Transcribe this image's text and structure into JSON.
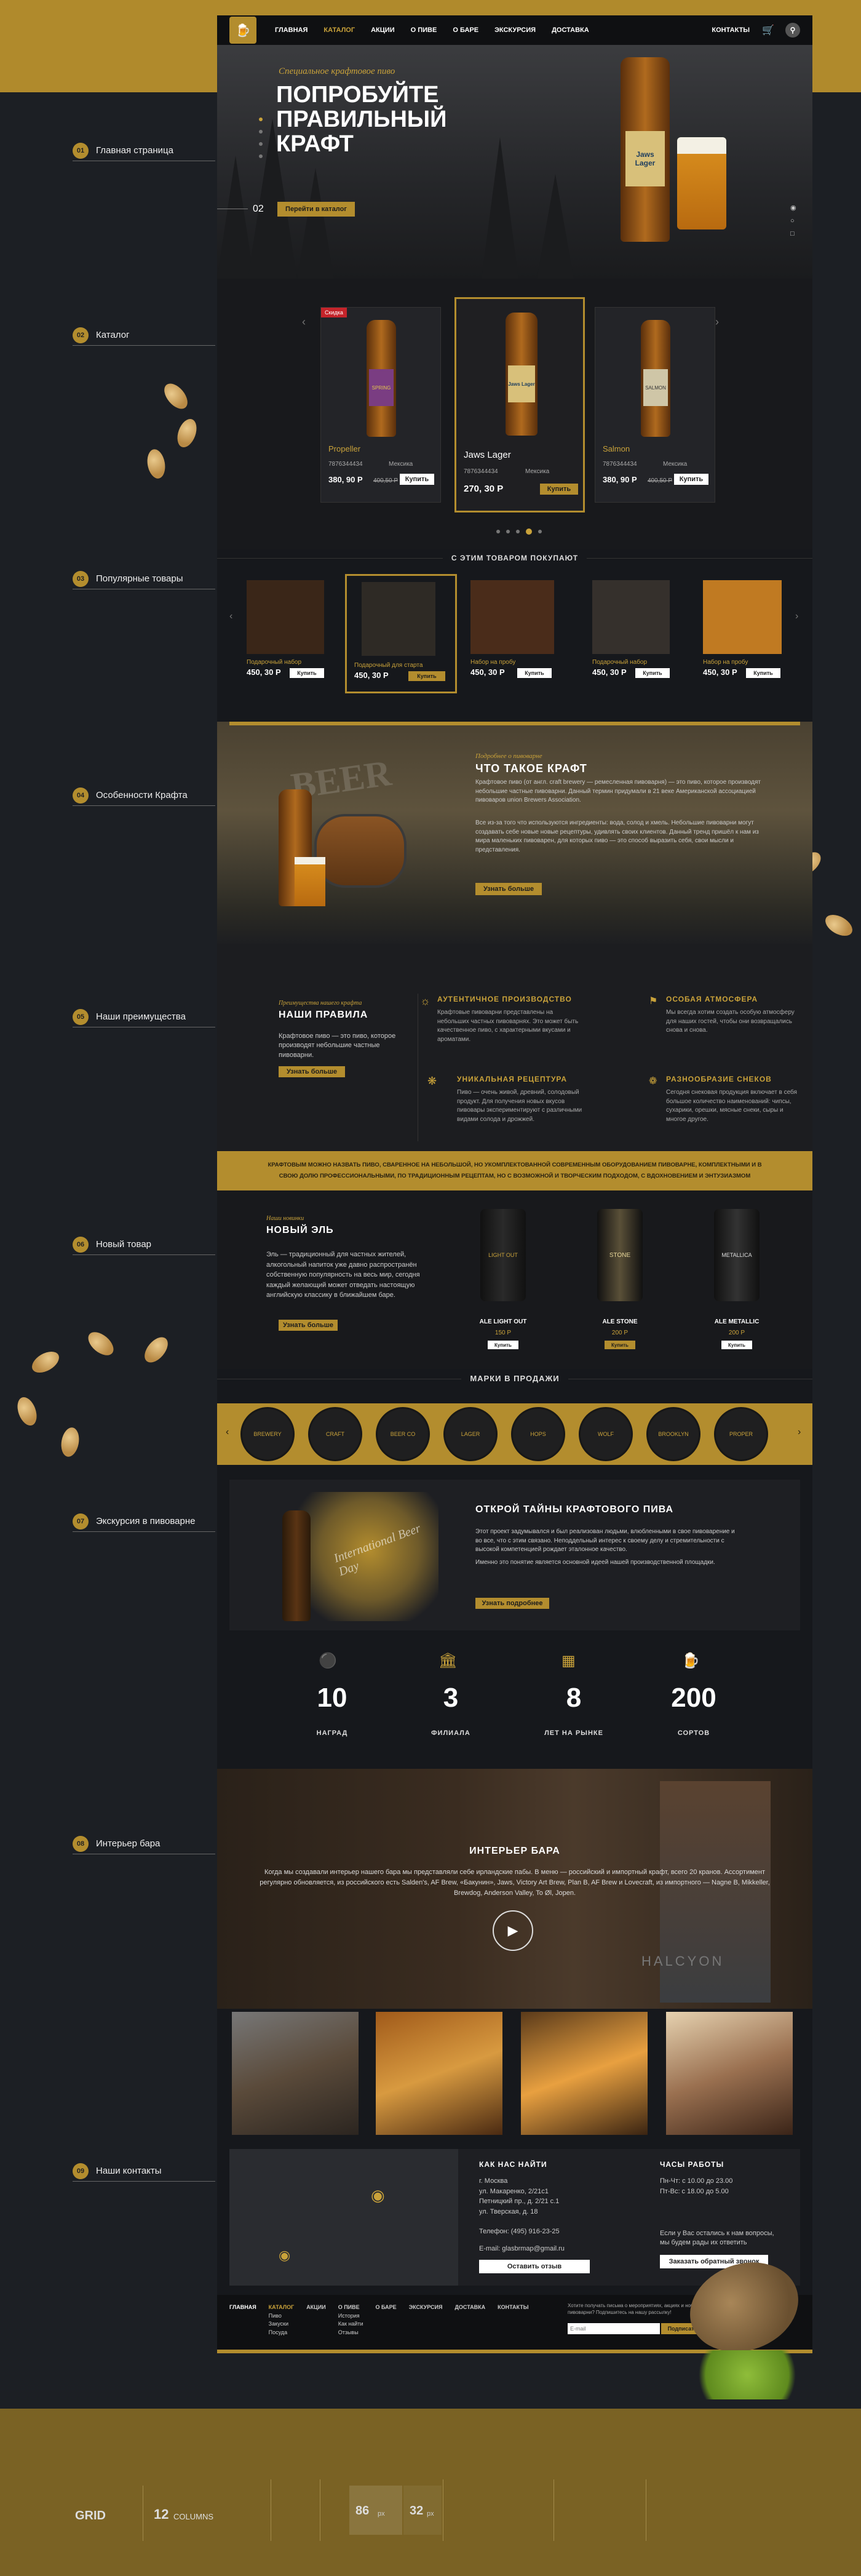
{
  "nav": {
    "items": [
      "ГЛАВНАЯ",
      "КАТАЛОГ",
      "АКЦИИ",
      "О ПИВЕ",
      "О БАРЕ",
      "ЭКСКУРСИЯ",
      "ДОСТАВКА"
    ],
    "contacts": "КОНТАКТЫ"
  },
  "left_index": [
    {
      "num": "01",
      "label": "Главная страница"
    },
    {
      "num": "02",
      "label": "Каталог"
    },
    {
      "num": "03",
      "label": "Популярные товары"
    },
    {
      "num": "04",
      "label": "Особенности Крафта"
    },
    {
      "num": "05",
      "label": "Наши преимущества"
    },
    {
      "num": "06",
      "label": "Новый товар"
    },
    {
      "num": "07",
      "label": "Экскурсия в пивоварне"
    },
    {
      "num": "08",
      "label": "Интерьер бара"
    },
    {
      "num": "09",
      "label": "Наши контакты"
    }
  ],
  "hero": {
    "script": "Специальное крафтовое пиво",
    "title1": "ПОПРОБУЙТЕ",
    "title2": "ПРАВИЛЬНЫЙ",
    "title3": "КРАФТ",
    "slide": "02",
    "button": "Перейти в каталог",
    "bottle_label": "Jaws Lager"
  },
  "catalog": {
    "products": [
      {
        "name": "Propeller",
        "code": "7876344434",
        "tag": "Мексика",
        "price": "380, 90 Р",
        "old": "400,50 Р",
        "btn": "Купить",
        "badge": "Скидка",
        "label": "SPRING"
      },
      {
        "name": "Jaws Lager",
        "code": "7876344434",
        "tag": "Мексика",
        "price": "270, 30 Р",
        "old": "",
        "btn": "Купить",
        "badge": "",
        "label": "Jaws Lager"
      },
      {
        "name": "Salmon",
        "code": "7876344434",
        "tag": "Мексика",
        "price": "380, 90 Р",
        "old": "400,50 Р",
        "btn": "Купить",
        "badge": "",
        "label": "SALMON"
      }
    ]
  },
  "popular": {
    "title": "С ЭТИМ ТОВАРОМ ПОКУПАЮТ",
    "items": [
      {
        "name": "Подарочный набор",
        "price": "450, 30 Р",
        "btn": "Купить"
      },
      {
        "name": "Подарочный для старта",
        "price": "450, 30 Р",
        "btn": "Купить"
      },
      {
        "name": "Набор на пробу",
        "price": "450, 30 Р",
        "btn": "Купить"
      },
      {
        "name": "Подарочный набор",
        "price": "450, 30 Р",
        "btn": "Купить"
      },
      {
        "name": "Набор на пробу",
        "price": "450, 30 Р",
        "btn": "Купить"
      }
    ]
  },
  "craft": {
    "script": "Подробнее о пивоварне",
    "title": "ЧТО ТАКОЕ КРАФТ",
    "text1": "Крафтовое пиво (от англ. craft brewery — ремесленная пивоварня) — это пиво, которое производят небольшие частные пивоварни. Данный термин придумали в 21 веке Американской ассоциацией пивоваров union Brewers Association.",
    "text2": "Все из-за того что используются ингредиенты: вода, солод и хмель. Небольшие пивоварни могут создавать себе новые новые рецептуры, удивлять своих клиентов. Данный тренд пришёл к нам из мира маленьких пивоварен, для которых пиво — это способ выразить себя, свои мысли и представления.",
    "button": "Узнать больше",
    "barrel_text": "BEER"
  },
  "advantages": {
    "script": "Преимущества нашего крафта",
    "title": "НАШИ ПРАВИЛА",
    "text": "Крафтовое пиво — это пиво, которое производят небольшие частные пивоварни.",
    "button": "Узнать больше",
    "features": [
      {
        "title": "АУТЕНТИЧНОЕ ПРОИЗВОДСТВО",
        "text": "Крафтовые пивоварни представлены на небольших частных пивоварнях. Это может быть качественное пиво, с характерными вкусами и ароматами."
      },
      {
        "title": "ОСОБАЯ АТМОСФЕРА",
        "text": "Мы всегда хотим создать особую атмосферу для наших гостей, чтобы они возвращались снова и снова."
      },
      {
        "title": "УНИКАЛЬНАЯ РЕЦЕПТУРА",
        "text": "Пиво — очень живой, древний, солодовый продукт. Для получения новых вкусов пивовары экспериментируют с различными видами солода и дрожжей."
      },
      {
        "title": "РАЗНООБРАЗИЕ СНЕКОВ",
        "text": "Сегодня снековая продукция включает в себя большое количество наименований: чипсы, сухарики, орешки, мясные снеки, сыры и многое другое."
      }
    ]
  },
  "banner": {
    "text": "КРАФТОВЫМ МОЖНО НАЗВАТЬ ПИВО, СВАРЕННОЕ НА НЕБОЛЬШОЙ, НО УКОМПЛЕКТОВАННОЙ СОВРЕМЕННЫМ ОБОРУДОВАНИЕМ ПИВОВАРНЕ, КОМПЛЕКТНЫМИ И В СВОЮ ДОЛЮ ПРОФЕССИОНАЛЬНЫМИ, ПО ТРАДИЦИОННЫМ РЕЦЕПТАМ, НО С ВОЗМОЖНОЙ И ТВОРЧЕСКИМ ПОДХОДОМ, С ВДОХНОВЕНИЕМ И ЭНТУЗИАЗМОМ"
  },
  "new_product": {
    "script": "Наши новинки",
    "title": "НОВЫЙ ЭЛЬ",
    "text": "Эль — традиционный для частных жителей, алкогольный напиток уже давно распространён собственную популярность на весь мир, сегодня каждый желающий может отведать настоящую английскую классику в ближайшем баре.",
    "button": "Узнать больше",
    "cans": [
      {
        "name": "ALE LIGHT OUT",
        "price": "150 Р",
        "btn": "Купить",
        "label": "LIGHT OUT"
      },
      {
        "name": "ALE STONE",
        "price": "200 Р",
        "btn": "Купить",
        "label": "STONE"
      },
      {
        "name": "ALE METALLIC",
        "price": "200 Р",
        "btn": "Купить",
        "label": "METALLICA"
      }
    ]
  },
  "brands": {
    "title": "МАРКИ В ПРОДАЖИ",
    "logos": [
      "BREWERY",
      "CRAFT",
      "BEER CO",
      "LAGER",
      "HOPS",
      "WOLF",
      "BROOKLYN",
      "PROPER"
    ]
  },
  "tour": {
    "title": "ОТКРОЙ ТАЙНЫ КРАФТОВОГО ПИВА",
    "text1": "Этот проект задумывался и был реализован людьми, влюбленными в свое пивоварение и во все, что с этим связано. Неподдельный интерес к своему делу и стремительности с высокой компетенцией рождает эталонное качество.",
    "text2": "Именно это понятие является основной идеей нашей производственной площадки.",
    "button": "Узнать подробнее",
    "card_text": "International Beer Day"
  },
  "stats": [
    {
      "value": "10",
      "label": "НАГРАД"
    },
    {
      "value": "3",
      "label": "ФИЛИАЛА"
    },
    {
      "value": "8",
      "label": "ЛЕТ НА РЫНКЕ"
    },
    {
      "value": "200",
      "label": "СОРТОВ"
    }
  ],
  "interior": {
    "title": "ИНТЕРЬЕР БАРА",
    "text": "Когда мы создавали интерьер нашего бара мы представляли себе ирландские пабы. В меню — российский и импортный крафт, всего 20 кранов. Ассортимент регулярно обновляется, из российского есть Salden's, AF Brew, «Бакунин», Jaws, Victory Art Brew, Plan B, AF Brew и Lovecraft, из импортного — Nagne B, Mikkeller, Brewdog, Anderson Valley, To Øl, Jopen.",
    "shirt": "HALCYON"
  },
  "contacts": {
    "title": "КАК НАС НАЙТИ",
    "address": [
      "г. Москва",
      "ул. Макаренко, 2/21с1",
      "Петницкий пр., д. 2/21 с.1",
      "ул. Тверская, д. 18"
    ],
    "phone": "Телефон: (495) 916-23-25",
    "email": "E-mail: glasbrmap@gmail.ru",
    "review_btn": "Оставить отзыв",
    "hours_title": "ЧАСЫ РАБОТЫ",
    "hours": [
      "Пн-Чт: с 10.00 до 23.00",
      "Пт-Вс: с 18.00 до 5.00"
    ],
    "question": "Если у Вас остались к нам вопросы, мы будем рады их ответить",
    "callback_btn": "Заказать обратный звонок"
  },
  "footer": {
    "cols": [
      [
        "ГЛАВНАЯ"
      ],
      [
        "КАТАЛОГ",
        "Пиво",
        "Закуски",
        "Посуда"
      ],
      [
        "АКЦИИ"
      ],
      [
        "О ПИВЕ",
        "История",
        "Как найти",
        "Отзывы"
      ],
      [
        "О БАРЕ"
      ],
      [
        "ЭКСКУРСИЯ"
      ],
      [
        "ДОСТАВКА"
      ],
      [
        "КОНТАКТЫ"
      ]
    ],
    "subscribe_text": "Хотите получать письма о мероприятиях, акциях и новинках пивоварни? Подпишитесь на нашу рассылку!",
    "email_placeholder": "E-mail",
    "subscribe_btn": "Подписаться"
  },
  "grid": {
    "title": "GRID",
    "columns_num": "12",
    "columns_label": "COLUMNS",
    "col_width": "86",
    "gutter": "32",
    "unit": "px"
  },
  "colors": {
    "accent": "#b38d2e",
    "page": "#16181c",
    "background": "#1c1f24"
  }
}
